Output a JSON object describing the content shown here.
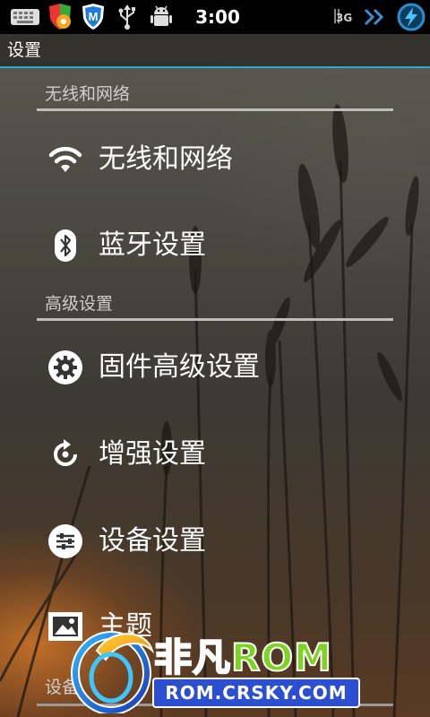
{
  "status_bar": {
    "time": "3:00",
    "network": "3G",
    "icons": [
      "keyboard-icon",
      "security-shield-icon",
      "mcafee-icon",
      "usb-icon",
      "android-debug-icon",
      "signal-3g-icon",
      "data-arrows-icon",
      "battery-charging-icon"
    ]
  },
  "title_bar": {
    "title": "设置"
  },
  "sections": [
    {
      "header": "无线和网络",
      "items": [
        {
          "label": "无线和网络",
          "icon": "wifi-icon"
        },
        {
          "label": "蓝牙设置",
          "icon": "bluetooth-icon"
        }
      ]
    },
    {
      "header": "高级设置",
      "items": [
        {
          "label": "固件高级设置",
          "icon": "firmware-gear-icon"
        },
        {
          "label": "增强设置",
          "icon": "enhance-refresh-icon"
        },
        {
          "label": "设备设置",
          "icon": "device-sliders-icon"
        },
        {
          "label": "主题",
          "icon": "theme-picture-icon"
        }
      ]
    },
    {
      "header": "设备"
    }
  ],
  "watermark": {
    "brand_cn": "非凡",
    "brand_en": "ROM",
    "url": "ROM.CRSKY.COM"
  },
  "colors": {
    "accent": "#33a6d8",
    "watermark_blue": "#2b4fd0",
    "watermark_green": "#7bd41f"
  }
}
